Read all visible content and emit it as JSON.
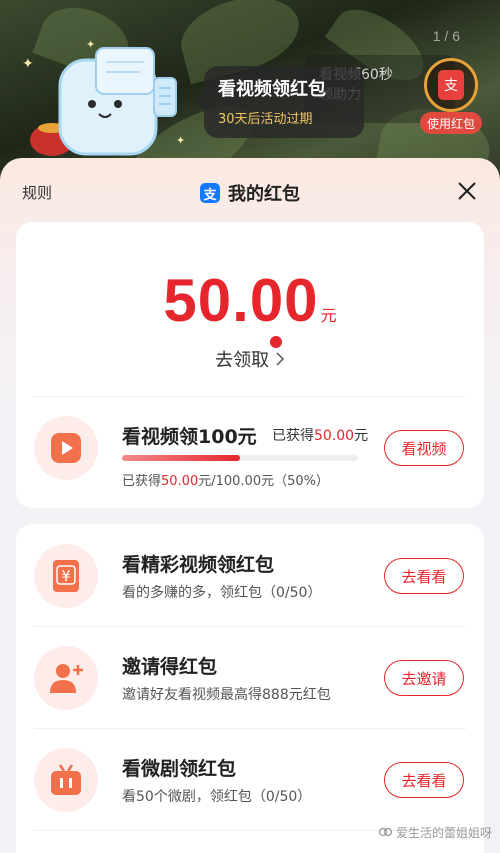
{
  "background": {
    "page_indicator": "1 / 6",
    "video_hint": {
      "line1": "看视频60秒",
      "line2": "领助力"
    },
    "use_badge_label": "使用红包",
    "use_badge_glyph": "支"
  },
  "tooltip": {
    "title": "看视频领红包",
    "subtitle": "30天后活动过期"
  },
  "sheet": {
    "rules_label": "规则",
    "title": "我的红包",
    "alipay_glyph": "支"
  },
  "balance": {
    "amount": "50.00",
    "unit": "元",
    "claim_label": "去领取"
  },
  "featured_task": {
    "title": "看视频领100元",
    "earned_prefix": "已获得",
    "earned_value": "50.00",
    "earned_unit": "元",
    "progress_prefix": "已获得",
    "progress_current": "50.00",
    "progress_rest": "元/100.00元（50%）",
    "progress_fraction": 0.5,
    "button_label": "看视频"
  },
  "tasks": [
    {
      "title": "看精彩视频领红包",
      "desc": "看的多赚的多，领红包（0/50）",
      "button": "去看看",
      "icon": "red-envelope-icon"
    },
    {
      "title": "邀请得红包",
      "desc": "邀请好友看视频最高得888元红包",
      "button": "去邀请",
      "icon": "add-user-icon"
    },
    {
      "title": "看微剧领红包",
      "desc": "看50个微剧，领红包（0/50）",
      "button": "去看看",
      "icon": "tv-icon"
    }
  ],
  "watermark": "爱生活的蕾姐姐呀",
  "colors": {
    "accent": "#e5262c",
    "alipay": "#1677ff"
  }
}
